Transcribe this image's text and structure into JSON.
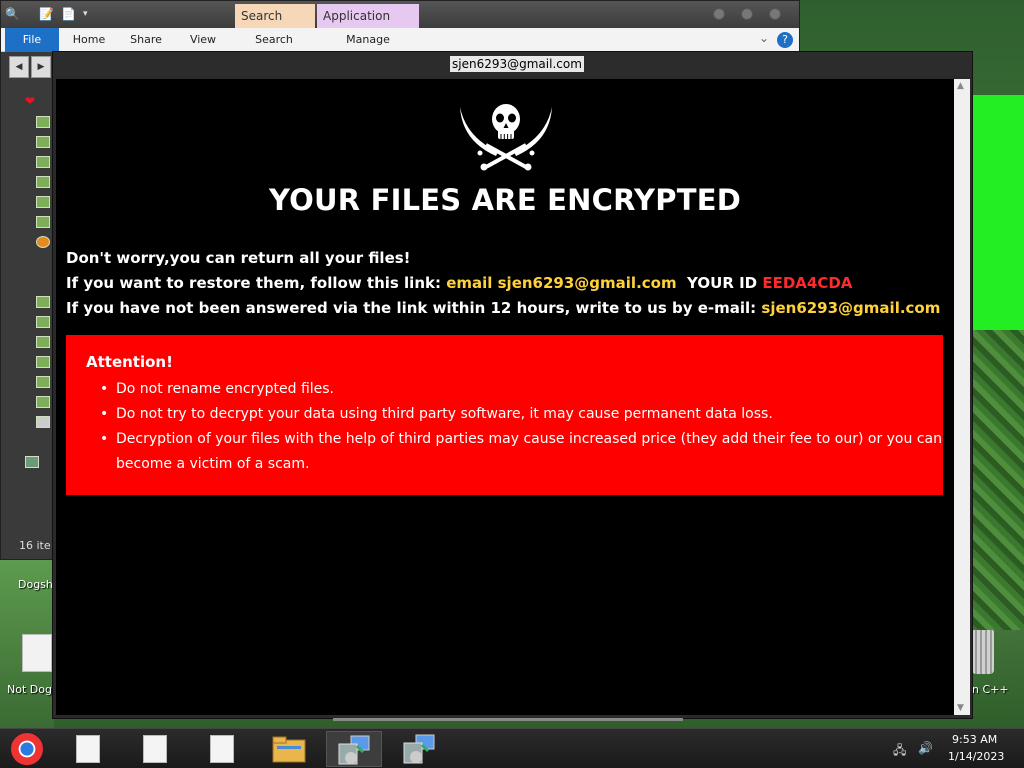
{
  "explorer": {
    "context_tabs": [
      "Search Tools",
      "Application Tools"
    ],
    "ribbon_tabs": [
      "File",
      "Home",
      "Share",
      "View",
      "Search",
      "Manage"
    ],
    "item_count": "16 ite"
  },
  "desktop": {
    "icons": [
      "Dogsh",
      "Not Dog",
      "n C++"
    ]
  },
  "ransom_window": {
    "title": "sjen6293@gmail.com",
    "headline": "YOUR FILES ARE ENCRYPTED",
    "line1": "Don't worry,you can return all your files!",
    "line2_prefix": "If you want to restore them, follow this link: ",
    "line2_link": "email sjen6293@gmail.com",
    "line2_id_label": "  YOUR ID ",
    "line2_id": "EEDA4CDA",
    "line3_prefix": "If you have not been answered via the link within 12 hours, write to us by e-mail: ",
    "line3_email": "sjen6293@gmail.com",
    "attention_title": "Attention!",
    "bullets": [
      "Do not rename encrypted files.",
      "Do not try to decrypt your data using third party software, it may cause permanent data loss.",
      "Decryption of your files with the help of third parties may cause increased price (they add their fee to our) or you can become a victim of a scam."
    ]
  },
  "taskbar": {
    "time": "9:53 AM",
    "date": "1/14/2023"
  },
  "colors": {
    "accent_yellow": "#ffd23c",
    "id_red": "#ff2a2a",
    "attention_bg": "#ff0000"
  }
}
